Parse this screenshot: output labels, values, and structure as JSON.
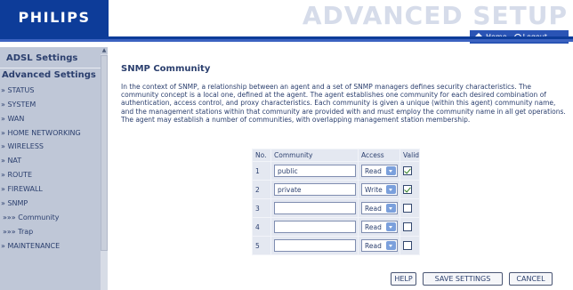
{
  "header": {
    "logo": "PHILIPS",
    "title": "ADVANCED SETUP",
    "home_label": "Home",
    "logout_label": "Logout"
  },
  "sidebar": {
    "adsl_label": "ADSL Settings",
    "advanced_label": "Advanced Settings",
    "items": [
      "» STATUS",
      "» SYSTEM",
      "» WAN",
      "» HOME NETWORKING",
      "» WIRELESS",
      "» NAT",
      "» ROUTE",
      "» FIREWALL",
      "» SNMP",
      "»»» Community",
      "»»» Trap",
      "» MAINTENANCE"
    ]
  },
  "page": {
    "title": "SNMP Community",
    "description": "In the context of SNMP, a relationship between an agent and a set of SNMP managers defines security characteristics. The community concept is a local one, defined at the agent. The agent establishes one community for each desired combination of authentication, access control, and proxy characteristics. Each community is given a unique (within this agent) community name, and the management stations within that community are provided with and must employ the community name in all get operations. The agent may establish a number of communities, with overlapping management station membership."
  },
  "table": {
    "headers": {
      "no": "No.",
      "community": "Community",
      "access": "Access",
      "valid": "Valid"
    },
    "rows": [
      {
        "no": "1",
        "community": "public",
        "access": "Read",
        "valid": true
      },
      {
        "no": "2",
        "community": "private",
        "access": "Write",
        "valid": true
      },
      {
        "no": "3",
        "community": "",
        "access": "Read",
        "valid": false
      },
      {
        "no": "4",
        "community": "",
        "access": "Read",
        "valid": false
      },
      {
        "no": "5",
        "community": "",
        "access": "Read",
        "valid": false
      }
    ]
  },
  "buttons": {
    "help": "HELP",
    "save": "SAVE SETTINGS",
    "cancel": "CANCEL"
  },
  "colors": {
    "brand_blue": "#0d3c99",
    "sidebar_bg": "#bfc7d7",
    "text": "#2b3f6e"
  }
}
